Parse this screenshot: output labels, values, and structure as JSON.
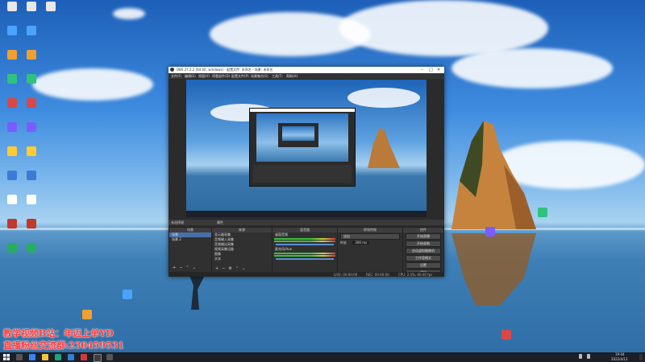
{
  "desktop": {
    "icons_left": [
      "",
      "",
      "",
      "",
      "",
      "",
      "",
      "",
      "",
      "",
      "",
      "",
      "",
      "",
      "",
      "",
      "",
      "",
      "",
      "",
      "",
      ""
    ],
    "watermark_line1": "教学视频B站：年迈上单YD",
    "watermark_line2": "直播粉丝交流群:230459531"
  },
  "obs": {
    "title": "OBS 27.2.2 (64 bit, windows) - 配置文件: 未命名 - 场景: 未命名",
    "menu": [
      "文件(F)",
      "编辑(E)",
      "视图(V)",
      "停靠部件(D)",
      "配置文件(P)",
      "场景集合(S)",
      "工具(T)",
      "帮助(H)"
    ],
    "scene_bar_label": "未选择源",
    "scene_bar_properties": "属性",
    "docks": {
      "scenes": {
        "title": "场景",
        "items": [
          "场景",
          "场景 2"
        ]
      },
      "sources": {
        "title": "来源",
        "items": [
          "显示器采集",
          "音频输入采集",
          "音频输出采集",
          "视频采集设备",
          "图像",
          "文本"
        ]
      },
      "mixer": {
        "title": "混音器",
        "channels": [
          "桌面音频",
          "麦克风/Aux"
        ]
      },
      "transitions": {
        "title": "转场特效",
        "type": "淡出",
        "duration_label": "时长",
        "duration": "300 ms"
      },
      "controls": {
        "title": "控件",
        "buttons": [
          "开始直播",
          "开始录制",
          "启动虚拟摄像机",
          "工作室模式",
          "设置",
          "退出"
        ]
      }
    },
    "status": [
      "LIVE: 00:00:00",
      "REC: 00:00:00",
      "CPU: 2.5%, 60.00 fps"
    ]
  },
  "taskbar": {
    "time": "19:04",
    "date": "2022/4/12"
  },
  "colors": {
    "watermark": "#ff3b3b",
    "obs_bg": "#2b2b2b",
    "obs_selected": "#4a6ea8"
  }
}
